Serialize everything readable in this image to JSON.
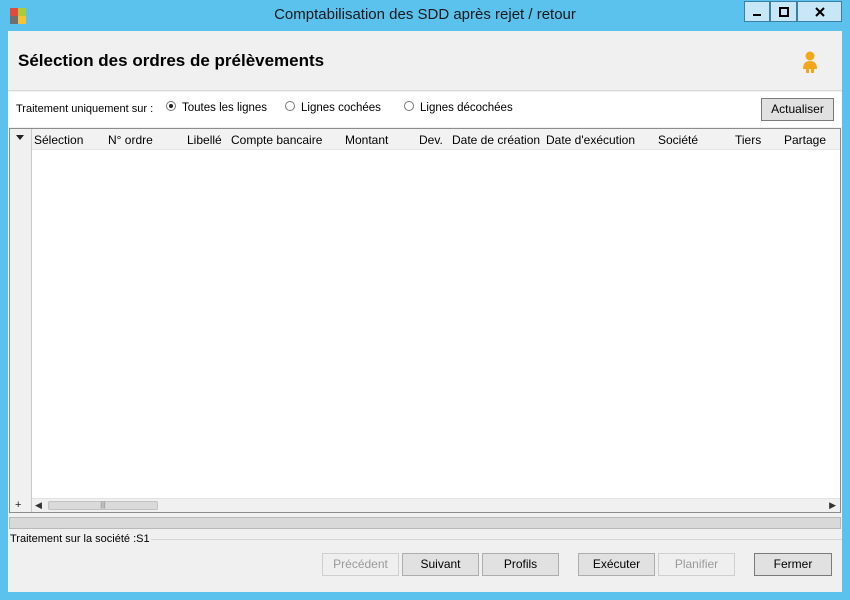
{
  "window": {
    "title": "Comptabilisation des SDD après rejet / retour",
    "controls": [
      "minimize-icon",
      "maximize-icon",
      "close-icon"
    ]
  },
  "header": {
    "title": "Sélection des ordres de prélèvements",
    "help_icon": "user-icon"
  },
  "filter": {
    "label": "Traitement uniquement sur :",
    "options": [
      {
        "label": "Toutes les lignes",
        "selected": true
      },
      {
        "label": "Lignes cochées",
        "selected": false
      },
      {
        "label": "Lignes décochées",
        "selected": false
      }
    ],
    "refresh_label": "Actualiser"
  },
  "grid": {
    "columns": [
      "Sélection",
      "N° ordre",
      "Libellé",
      "Compte bancaire",
      "Montant",
      "Dev.",
      "Date de création",
      "Date d'exécution",
      "Société",
      "Tiers",
      "Partage"
    ],
    "rows": []
  },
  "status": {
    "text": "Traitement sur la société :S1"
  },
  "footer": {
    "buttons": [
      {
        "label": "Précédent",
        "enabled": false
      },
      {
        "label": "Suivant",
        "enabled": true
      },
      {
        "label": "Profils",
        "enabled": true
      },
      {
        "label": "Exécuter",
        "enabled": true
      },
      {
        "label": "Planifier",
        "enabled": false
      },
      {
        "label": "Fermer",
        "enabled": true
      }
    ]
  },
  "colors": {
    "titlebar": "#5bc2ee",
    "panel": "#f0f0f0",
    "accent_user": "#f2a71b"
  }
}
